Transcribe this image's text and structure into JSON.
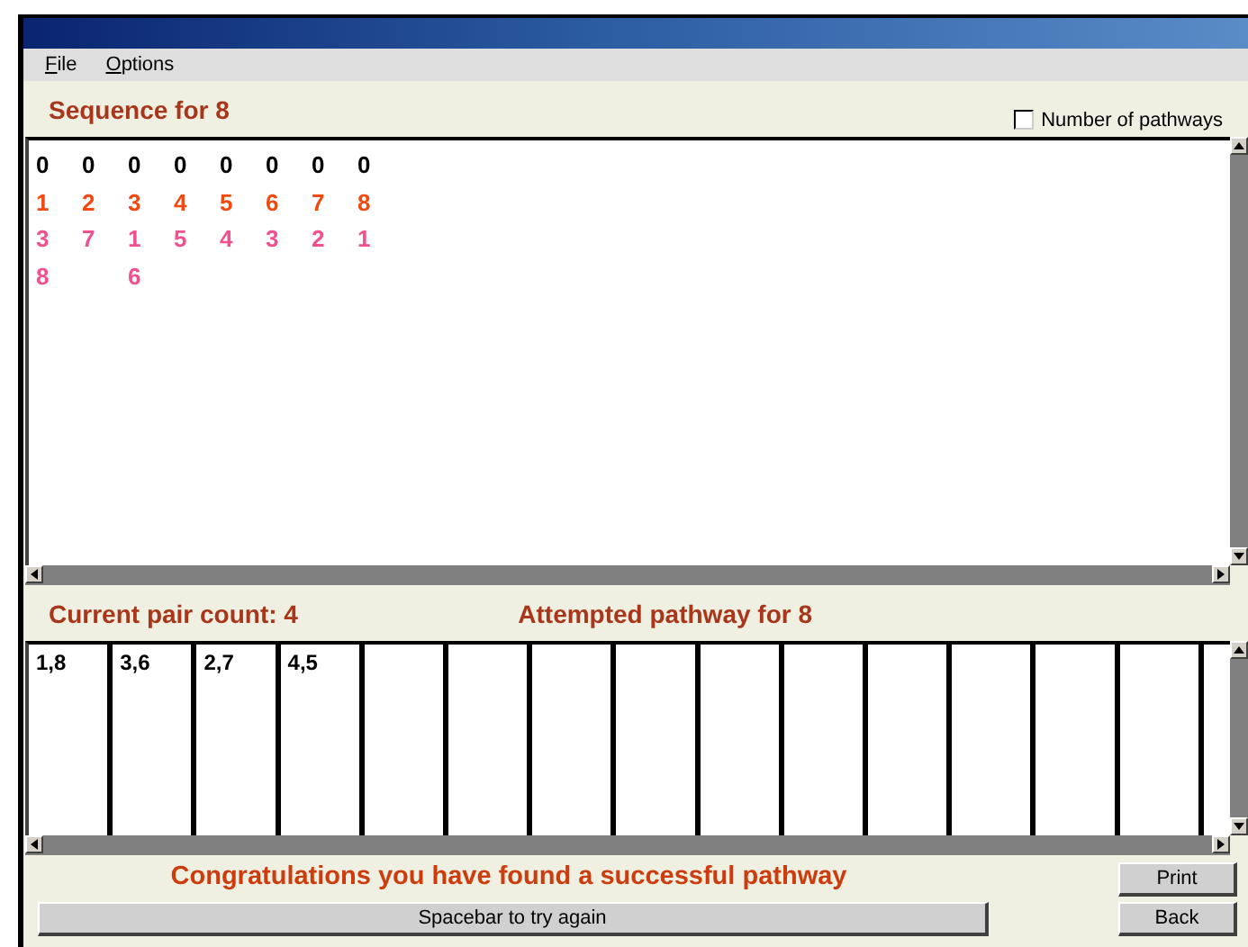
{
  "menu": [
    {
      "label": "File"
    },
    {
      "label": "Options"
    }
  ],
  "sequence_heading": "Sequence for 8",
  "number_of_pathways": {
    "label": "Number of pathways",
    "checked": false
  },
  "sequence_row_colors": [
    {
      "color": "#000000"
    },
    {
      "color": "#f04a10"
    },
    {
      "color": "#f05090"
    },
    {
      "color": "#f05090"
    }
  ],
  "sequence_columns": [
    [
      "0",
      "1",
      "3",
      "8"
    ],
    [
      "0",
      "2",
      "7"
    ],
    [
      "0",
      "3",
      "1",
      "6"
    ],
    [
      "0",
      "4",
      "5"
    ],
    [
      "0",
      "5",
      "4"
    ],
    [
      "0",
      "6",
      "3"
    ],
    [
      "0",
      "7",
      "2"
    ],
    [
      "0",
      "8",
      "1"
    ]
  ],
  "pair_count": "Current pair count: 4",
  "pathway_heading": "Attempted pathway for 8",
  "pathway_cells": [
    "1,8",
    "3,6",
    "2,7",
    "4,5"
  ],
  "message": "Congratulations you have found a successful pathway",
  "try_again": "Spacebar to try again",
  "buttons": [
    "Print",
    "Back"
  ]
}
